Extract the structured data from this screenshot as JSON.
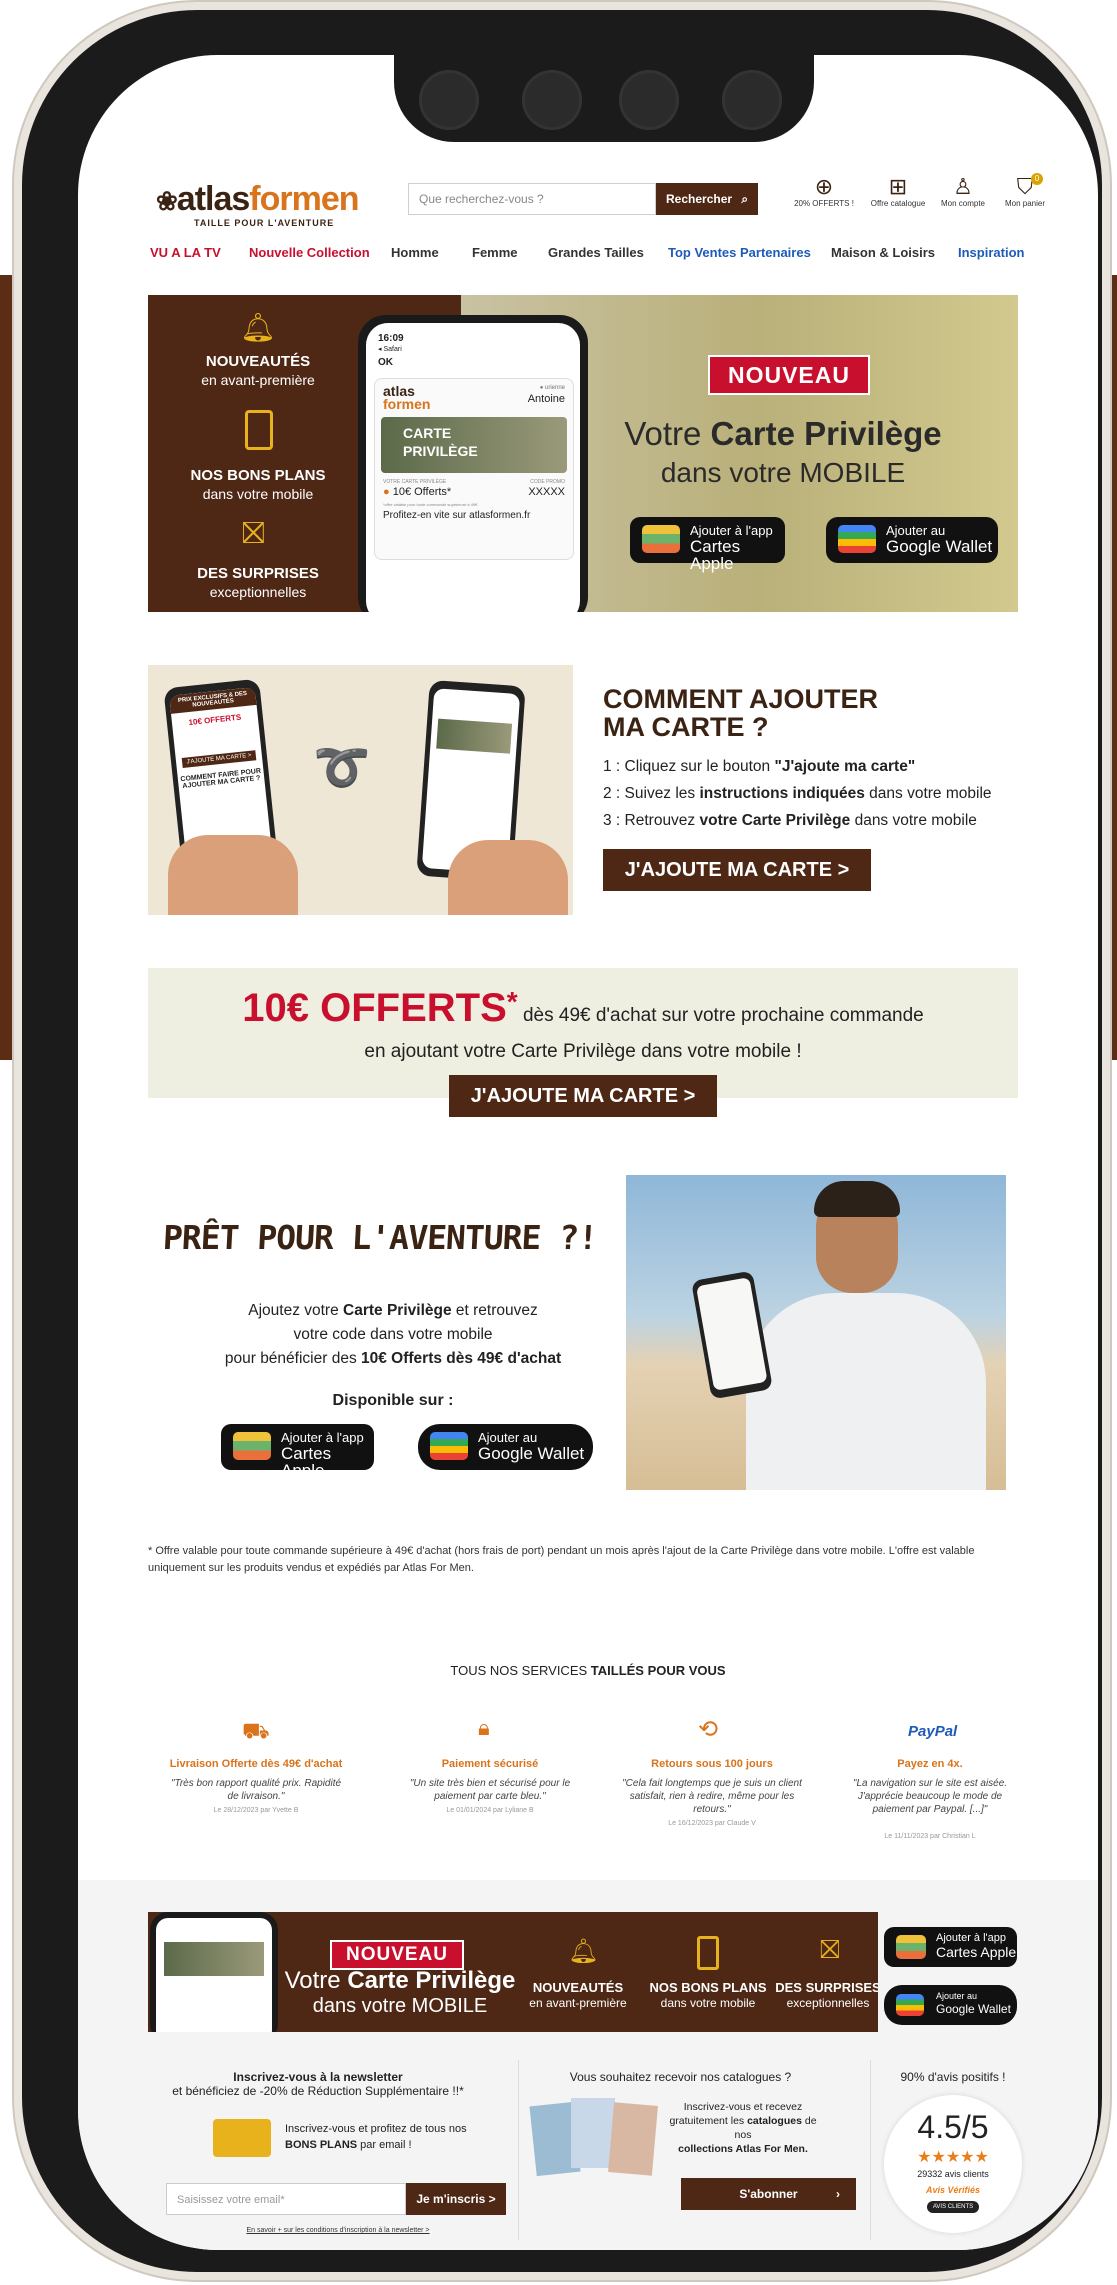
{
  "header": {
    "logo_a": "atlas",
    "logo_b": "formen",
    "tagline": "TAILLE POUR L'AVENTURE",
    "search_placeholder": "Que recherchez-vous ?",
    "search_button": "Rechercher",
    "icons": [
      {
        "label": "20% OFFERTS !",
        "icon": "gift-icon"
      },
      {
        "label": "Offre catalogue",
        "icon": "catalog-icon"
      },
      {
        "label": "Mon compte",
        "icon": "user-icon"
      },
      {
        "label": "Mon panier",
        "icon": "cart-icon",
        "badge": "0"
      }
    ]
  },
  "nav": [
    {
      "label": "VU A LA TV",
      "color": "#c8102e"
    },
    {
      "label": "Nouvelle Collection",
      "color": "#c8102e"
    },
    {
      "label": "Homme",
      "color": "#333333"
    },
    {
      "label": "Femme",
      "color": "#333333"
    },
    {
      "label": "Grandes Tailles",
      "color": "#333333"
    },
    {
      "label": "Top Ventes Partenaires",
      "color": "#1e5bb8"
    },
    {
      "label": "Maison & Loisirs",
      "color": "#333333"
    },
    {
      "label": "Inspiration",
      "color": "#1e5bb8"
    }
  ],
  "hero": {
    "benefits": [
      {
        "title": "NOUVEAUTÉS",
        "sub": "en avant-première"
      },
      {
        "title": "NOS BONS PLANS",
        "sub": "dans votre mobile"
      },
      {
        "title": "DES SURPRISES",
        "sub": "exceptionnelles"
      }
    ],
    "phone": {
      "time": "16:09",
      "back": "◂ Safari",
      "ok": "OK",
      "name_label": "● urienne",
      "name": "Antoine",
      "card_title_1": "CARTE",
      "card_title_2": "PRIVILÈGE",
      "offer_label": "VOTRE CARTE PRIVILÈGE",
      "offer": "10€ Offerts*",
      "code_label": "CODE PROMO",
      "code": "XXXXX",
      "fine": "*offre valable pour toute commande supérieure à 49€",
      "note": "Profitez-en vite sur atlasformen.fr"
    },
    "badge": "NOUVEAU",
    "title_pre": "Votre ",
    "title_bold": "Carte Privilège",
    "title_sub": "dans votre MOBILE",
    "apple_small": "Ajouter à l'app",
    "apple_big": "Cartes Apple",
    "google_small": "Ajouter au",
    "google_big": "Google Wallet"
  },
  "how": {
    "title_1": "COMMENT AJOUTER",
    "title_2": "MA CARTE ?",
    "steps": [
      {
        "pre": "1 : Cliquez sur le bouton ",
        "bold": "\"J'ajoute ma carte\"",
        "post": ""
      },
      {
        "pre": "2 : Suivez les ",
        "bold": "instructions indiquées",
        "post": " dans votre mobile"
      },
      {
        "pre": "3 : Retrouvez ",
        "bold": "votre Carte Privilège",
        "post": "  dans votre mobile"
      }
    ],
    "cta": "J'AJOUTE MA CARTE >",
    "phone_left_title": "PRIX EXCLUSIFS & DES NOUVEAUTÉS",
    "phone_left_offer": "10€ OFFERTS",
    "phone_left_btn": "J'AJOUTE MA CARTE >",
    "phone_left_q": "COMMENT FAIRE POUR AJOUTER MA CARTE ?"
  },
  "offer": {
    "big": "10€ OFFERTS",
    "star": "*",
    "rest": " dès 49€ d'achat sur votre prochaine commande",
    "line2": "en ajoutant votre Carte Privilège dans votre mobile !",
    "cta": "J'AJOUTE MA CARTE >"
  },
  "adventure": {
    "title": "PRÊT POUR L'AVENTURE ?!",
    "p1_pre": "Ajoutez votre ",
    "p1_bold": "Carte Privilège",
    "p1_post": " et retrouvez",
    "p2": "votre code dans votre mobile",
    "p3_pre": "pour bénéficier des ",
    "p3_bold": "10€ Offerts dès 49€ d'achat",
    "available": "Disponible sur :"
  },
  "disclaimer": "* Offre valable pour toute commande supérieure à 49€ d'achat (hors frais de port) pendant un mois après l'ajout de la Carte Privilège dans votre mobile. L'offre est valable uniquement sur les produits vendus et expédiés par Atlas For Men.",
  "services": {
    "heading_pre": "TOUS NOS SERVICES ",
    "heading_bold": "TAILLÉS POUR VOUS",
    "items": [
      {
        "icon": "truck-icon",
        "title": "Livraison Offerte dès 49€ d'achat",
        "quote": "\"Très bon rapport qualité prix. Rapidité de livraison.\"",
        "date": "Le 28/12/2023 par Yvette B"
      },
      {
        "icon": "lock-icon",
        "title": "Paiement sécurisé",
        "quote": "\"Un site très bien et sécurisé pour le paiement par carte bleu.\"",
        "date": "Le 01/01/2024 par Lyliane B"
      },
      {
        "icon": "return-icon",
        "title": "Retours sous 100 jours",
        "quote": "\"Cela fait longtemps que je suis un client satisfait, rien à redire, même pour les retours.\"",
        "date": "Le 16/12/2023 par Claude V"
      },
      {
        "icon": "paypal-icon",
        "icon_text": "PayPal",
        "title": "Payez en 4x.",
        "quote": "\"La navigation sur le site est aisée. J'apprécie beaucoup le mode de paiement par Paypal. [...]\"",
        "date": "Le 11/11/2023 par Christian L"
      }
    ]
  },
  "banner": {
    "badge": "NOUVEAU",
    "title_pre": "Votre ",
    "title_bold": "Carte Privilège",
    "title_sub": "dans votre MOBILE",
    "benefits": [
      {
        "title": "NOUVEAUTÉS",
        "sub": "en avant-première"
      },
      {
        "title": "NOS BONS PLANS",
        "sub": "dans votre mobile"
      },
      {
        "title": "DES SURPRISES",
        "sub": "exceptionnelles"
      }
    ]
  },
  "footer": {
    "newsletter_title": "Inscrivez-vous à la newsletter",
    "newsletter_sub": "et bénéficiez de -20% de Réduction Supplémentaire !!*",
    "newsletter_text_1": "Inscrivez-vous et profitez de tous nos",
    "newsletter_text_bold": "BONS PLANS",
    "newsletter_text_2": " par email !",
    "email_placeholder": "Saisissez votre email*",
    "subscribe": "Je m'inscris  >",
    "conditions": "En savoir + sur les conditions d'inscription à la newsletter >",
    "catalog_title": "Vous souhaitez recevoir nos catalogues ?",
    "catalog_text_1": "Inscrivez-vous et recevez",
    "catalog_text_2": "gratuitement les ",
    "catalog_text_bold": "catalogues",
    "catalog_text_3": " de nos",
    "catalog_text_4": "collections Atlas For Men.",
    "catalog_button": "S'abonner",
    "reviews_title": "90% d'avis positifs !",
    "score": "4.5/5",
    "stars": "★★★★★",
    "count": "29332 avis clients",
    "brand": "Avis Vérifiés",
    "client": "AVIS CLIENTS"
  },
  "colors": {
    "brown": "#4e2815",
    "red": "#c8102e",
    "orange": "#d9731c"
  }
}
